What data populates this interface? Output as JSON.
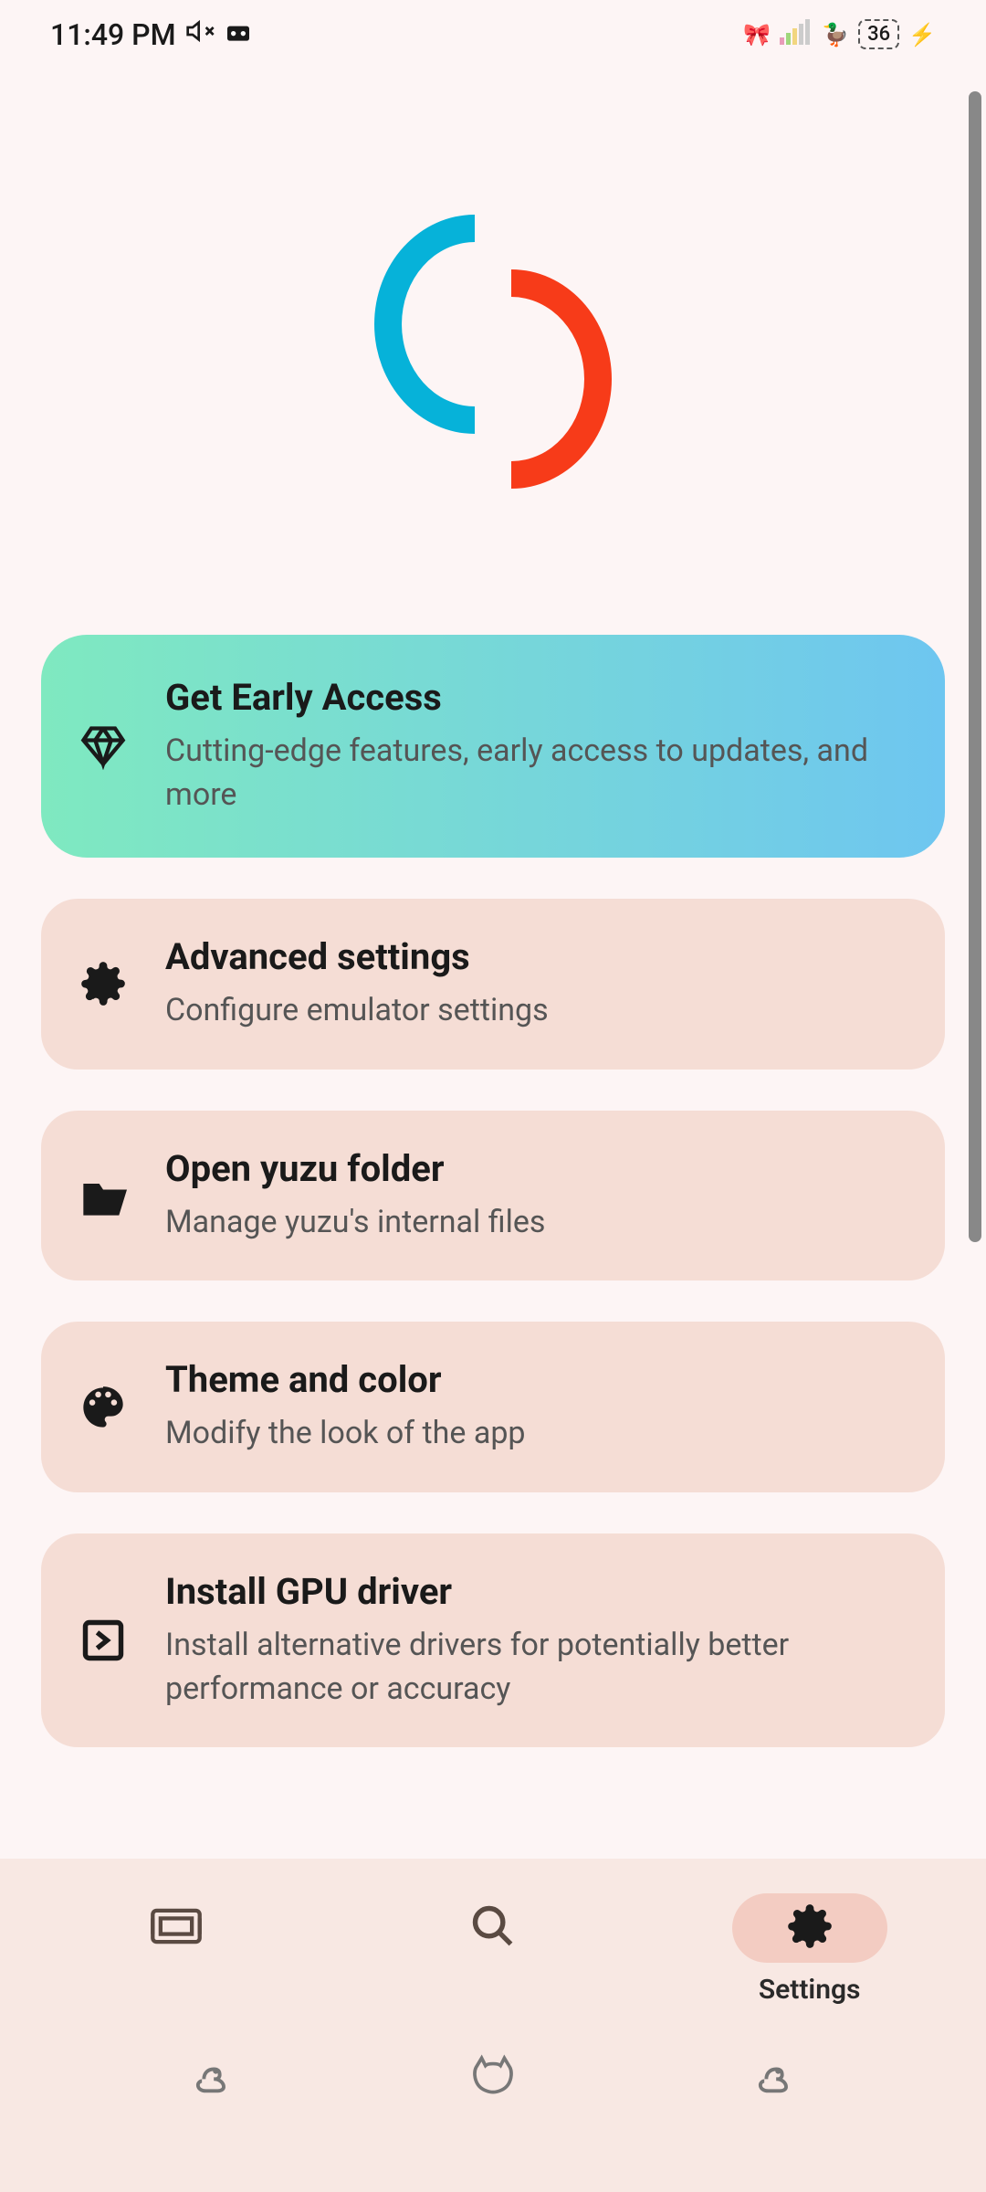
{
  "status_bar": {
    "time": "11:49 PM",
    "battery": "36"
  },
  "settings": {
    "items": [
      {
        "title": "Get Early Access",
        "subtitle": "Cutting-edge features, early access to updates, and more"
      },
      {
        "title": "Advanced settings",
        "subtitle": "Configure emulator settings"
      },
      {
        "title": "Open yuzu folder",
        "subtitle": "Manage yuzu's internal files"
      },
      {
        "title": "Theme and color",
        "subtitle": "Modify the look of the app"
      },
      {
        "title": "Install GPU driver",
        "subtitle": "Install alternative drivers for potentially better performance or accuracy"
      }
    ]
  },
  "nav": {
    "settings_label": "Settings"
  }
}
